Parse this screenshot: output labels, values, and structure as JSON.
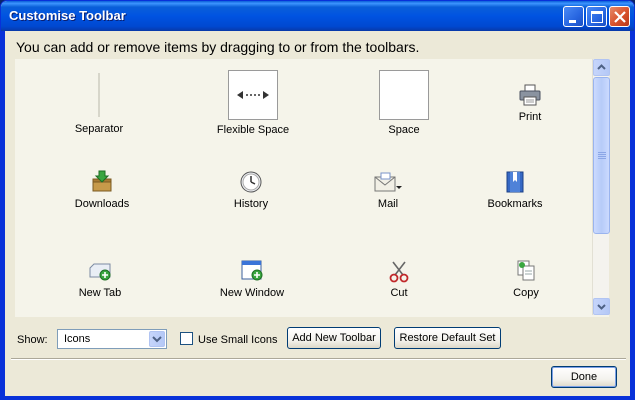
{
  "window": {
    "title": "Customise Toolbar",
    "buttons": [
      "minimize",
      "maximize",
      "close"
    ]
  },
  "instruction": "You can add or remove items by dragging to or from the toolbars.",
  "items": [
    {
      "label": "Separator",
      "icon": "separator-icon"
    },
    {
      "label": "Flexible Space",
      "icon": "flexible-space-icon"
    },
    {
      "label": "Space",
      "icon": "space-icon"
    },
    {
      "label": "Print",
      "icon": "printer-icon"
    },
    {
      "label": "Downloads",
      "icon": "downloads-icon"
    },
    {
      "label": "History",
      "icon": "clock-icon"
    },
    {
      "label": "Mail",
      "icon": "mail-icon"
    },
    {
      "label": "Bookmarks",
      "icon": "bookmarks-icon"
    },
    {
      "label": "New Tab",
      "icon": "new-tab-icon"
    },
    {
      "label": "New Window",
      "icon": "new-window-icon"
    },
    {
      "label": "Cut",
      "icon": "scissors-icon"
    },
    {
      "label": "Copy",
      "icon": "copy-icon"
    }
  ],
  "controls": {
    "show_label": "Show:",
    "show_value": "Icons",
    "small_icons_label": "Use Small Icons",
    "small_icons_checked": false,
    "add_toolbar_label": "Add New Toolbar",
    "restore_label": "Restore Default Set",
    "done_label": "Done"
  }
}
